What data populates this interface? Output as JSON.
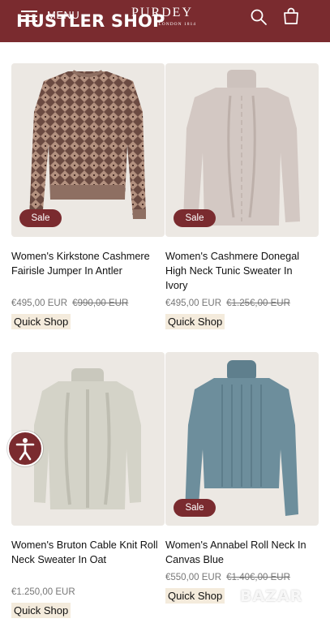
{
  "header": {
    "menu_label": "MENU",
    "overlay_title": "HUSTLER SHOP",
    "logo_name": "PURDEY",
    "logo_sub": "LONDON 1814",
    "bg_color": "#7a2b2f"
  },
  "products": [
    {
      "badge": "Sale",
      "title": "Women's Kirkstone Cashmere Fairisle Jumper In Antler",
      "price": "€495,00 EUR",
      "old_price": "€990,00 EUR",
      "quick_shop": "Quick Shop"
    },
    {
      "badge": "Sale",
      "title": "Women's Cashmere Donegal High Neck Tunic Sweater In Ivory",
      "price": "€495,00 EUR",
      "old_price": "€1.25€,00 EUR",
      "quick_shop": "Quick Shop"
    },
    {
      "badge": "",
      "title": "Women's Bruton Cable Knit Roll Neck Sweater In Oat",
      "price": "€1.250,00 EUR",
      "old_price": "",
      "quick_shop": "Quick Shop"
    },
    {
      "badge": "Sale",
      "title": "Women's Annabel Roll Neck In Canvas Blue",
      "price": "€550,00 EUR",
      "old_price": "€1.40€,00 EUR",
      "quick_shop": "Quick Shop"
    }
  ],
  "watermark": "BAZAR",
  "icons": [
    "menu-icon",
    "search-icon",
    "cart-icon",
    "accessibility-icon"
  ],
  "colors": {
    "brand": "#7a2b2f",
    "sale_badge": "#7a2b2f",
    "quick_shop_bg": "#f4ebdc"
  }
}
